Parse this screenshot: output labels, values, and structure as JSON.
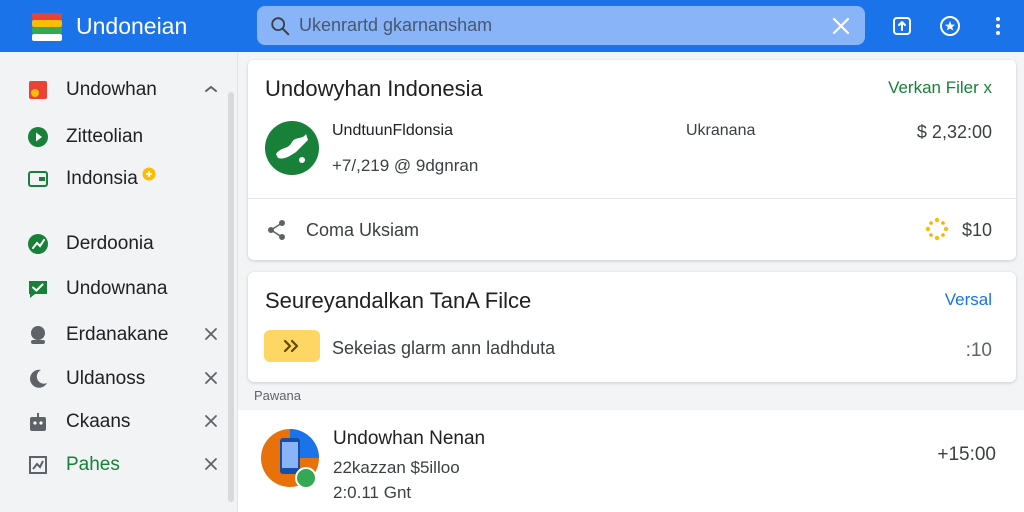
{
  "app": {
    "title": "Undoneian"
  },
  "search": {
    "placeholder": "Ukenrartd gkarnansham"
  },
  "colors": {
    "appbar": "#1a73e8",
    "accent_green": "#188038",
    "accent_blue": "#1a73e8"
  },
  "appbar_actions": [
    {
      "name": "share-box-icon"
    },
    {
      "name": "star-circle-icon"
    },
    {
      "name": "more-vert-icon"
    }
  ],
  "sidebar": {
    "items": [
      {
        "label": "Undowhan",
        "icon": "flag-icon",
        "trail": "chevron-up-icon"
      },
      {
        "label": "Zitteolian",
        "icon": "play-circle-icon"
      },
      {
        "label": "Indonsia",
        "icon": "wallet-icon",
        "badge": "badge-dot-icon"
      },
      {
        "label": "Derdoonia",
        "icon": "chart-circle-icon"
      },
      {
        "label": "Undownana",
        "icon": "chat-check-icon"
      },
      {
        "label": "Erdanakane",
        "icon": "person-icon",
        "trail": "close-icon"
      },
      {
        "label": "Uldanoss",
        "icon": "moon-icon",
        "trail": "close-icon"
      },
      {
        "label": "Ckaans",
        "icon": "robot-icon",
        "trail": "close-icon"
      },
      {
        "label": "Pahes",
        "icon": "growth-icon",
        "trail": "close-icon",
        "active": true
      }
    ]
  },
  "card1": {
    "title": "Undowyhan Indonesia",
    "link": "Verkan Filer x",
    "row": {
      "name": "UndtuunFldonsia",
      "sub": "+7/,219 @ 9dgnran",
      "middle": "Ukranana",
      "amount": "$ 2,32:00"
    },
    "footer": {
      "label": "Coma Uksiam",
      "value": "$10"
    }
  },
  "card2": {
    "title": "Seureyandalkan TanA Filce",
    "link": "Versal",
    "row": {
      "label": "Sekeias glarm ann ladhduta",
      "value": ":10"
    }
  },
  "section": {
    "label": "Pawana"
  },
  "list": {
    "items": [
      {
        "title": "Undowhan Nenan",
        "sub1": "22kazzan $5illoo",
        "sub2": "2:0.11 Gnt",
        "amount": "+15:00"
      }
    ]
  }
}
